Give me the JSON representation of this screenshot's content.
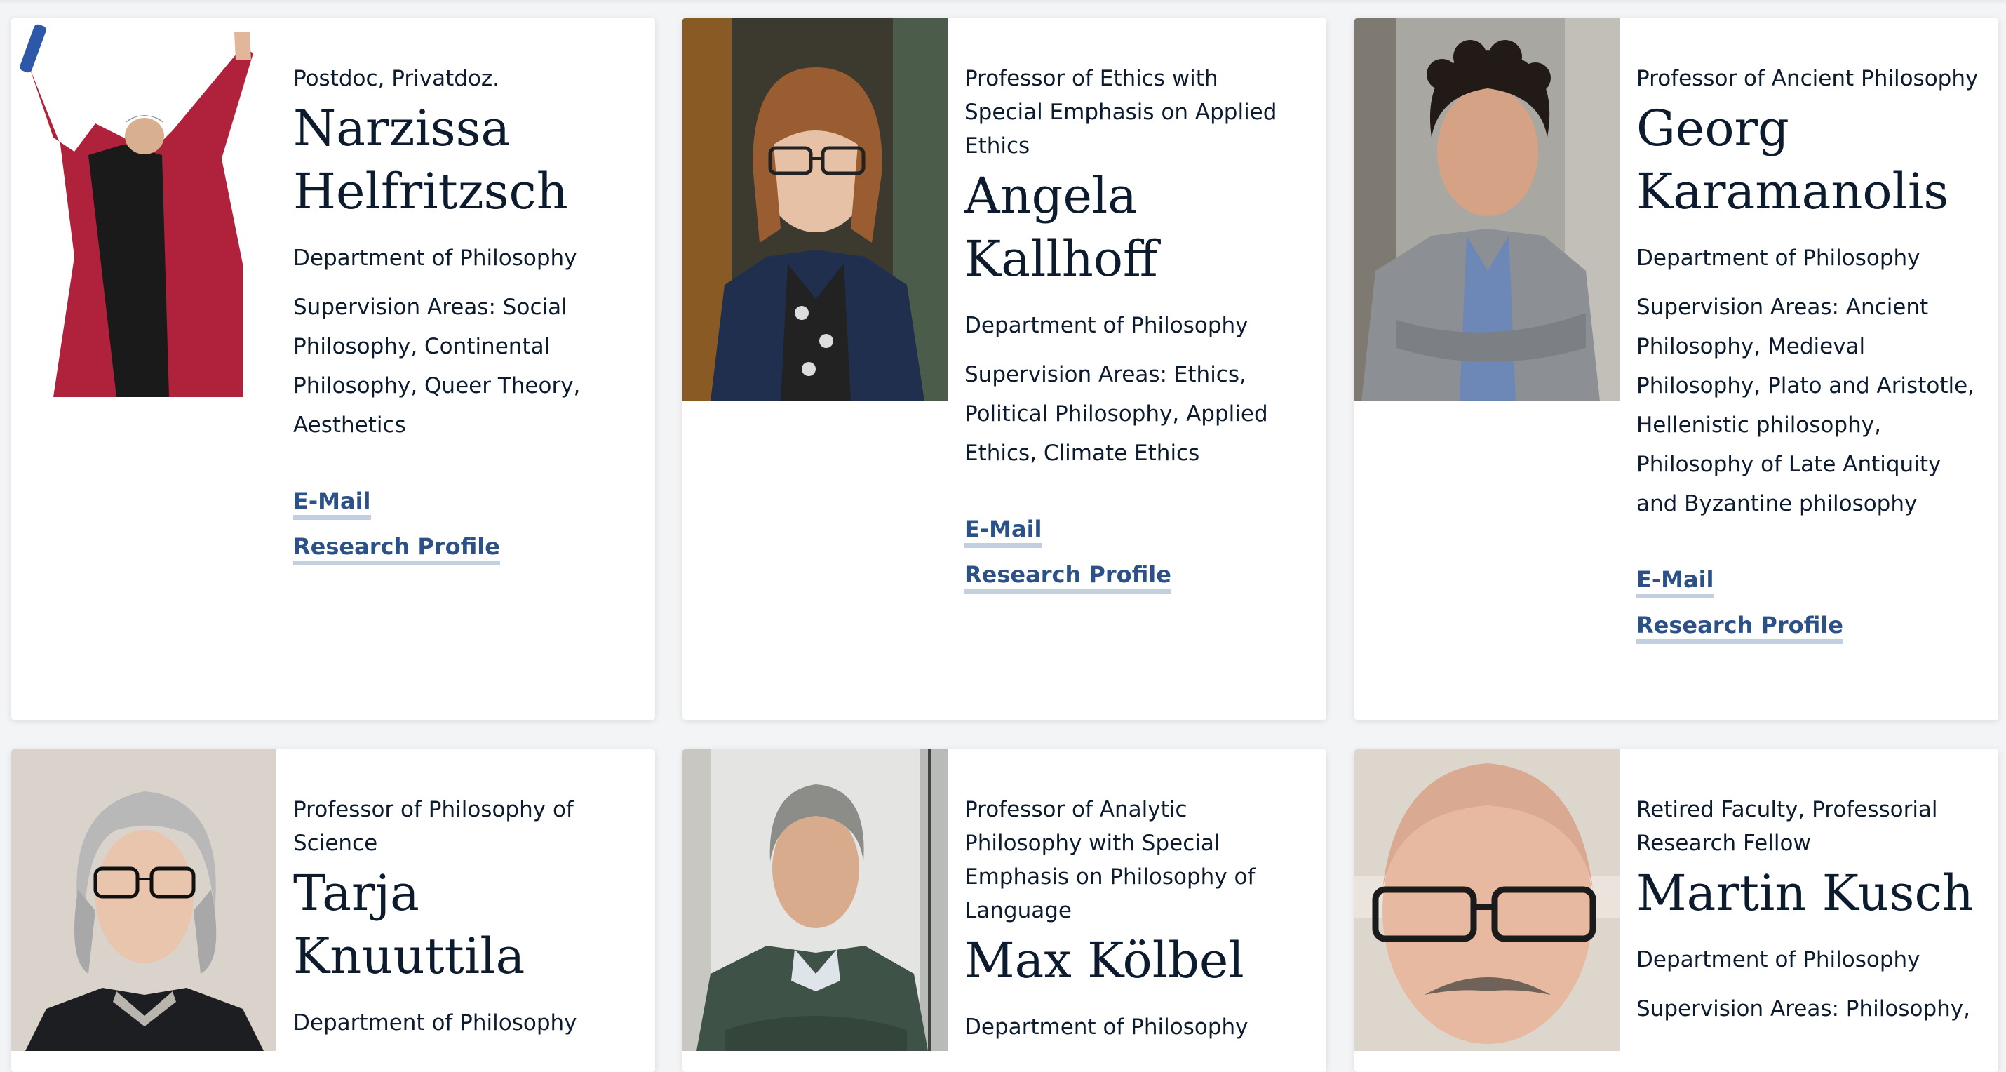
{
  "people": [
    {
      "role": "Postdoc, Privatdoz.",
      "name_line1": "Narzissa",
      "name_line2": "Helfritzsch",
      "department": "Department of Philosophy",
      "supervision": "Supervision Areas: Social Philosophy, Continental Philosophy, Queer Theory, Aesthetics",
      "email_label": "E-Mail",
      "profile_label": "Research Profile",
      "photo_desc": "person-in-red-fur-coat"
    },
    {
      "role": "Professor of Ethics with Special Emphasis on Applied Ethics",
      "name_line1": "Angela",
      "name_line2": "Kallhoff",
      "department": "Department of Philosophy",
      "supervision": "Supervision Areas: Ethics, Political Philosophy, Applied Ethics, Climate Ethics",
      "email_label": "E-Mail",
      "profile_label": "Research Profile",
      "photo_desc": "woman-with-glasses"
    },
    {
      "role": "Professor of Ancient Philosophy",
      "name_line1": "Georg",
      "name_line2": "Karamanolis",
      "department": "Department of Philosophy",
      "supervision": "Supervision Areas: Ancient Philosophy, Medieval Philosophy, Plato and Aristotle, Hellenistic philosophy, Philosophy of Late Antiquity and Byzantine philosophy",
      "email_label": "E-Mail",
      "profile_label": "Research Profile",
      "photo_desc": "man-in-grey-blazer"
    },
    {
      "role": "Professor of Philosophy of Science",
      "name_line1": "Tarja",
      "name_line2": "Knuuttila",
      "department": "Department of Philosophy",
      "photo_desc": "woman-with-grey-hair"
    },
    {
      "role": "Professor of Analytic Philosophy with Special Emphasis on Philosophy of Language",
      "name_line1": "Max Kölbel",
      "department": "Department of Philosophy",
      "photo_desc": "man-in-green-sweater"
    },
    {
      "role": "Retired Faculty, Professorial Research Fellow",
      "name_line1": "Martin Kusch",
      "department": "Department of Philosophy",
      "supervision": "Supervision Areas: Philosophy,",
      "photo_desc": "bald-man-with-glasses"
    }
  ],
  "colors": {
    "link": "#2b5188",
    "link_underline": "#c3cfe0",
    "text": "#0d1b2e",
    "page_bg": "#f3f4f6"
  }
}
